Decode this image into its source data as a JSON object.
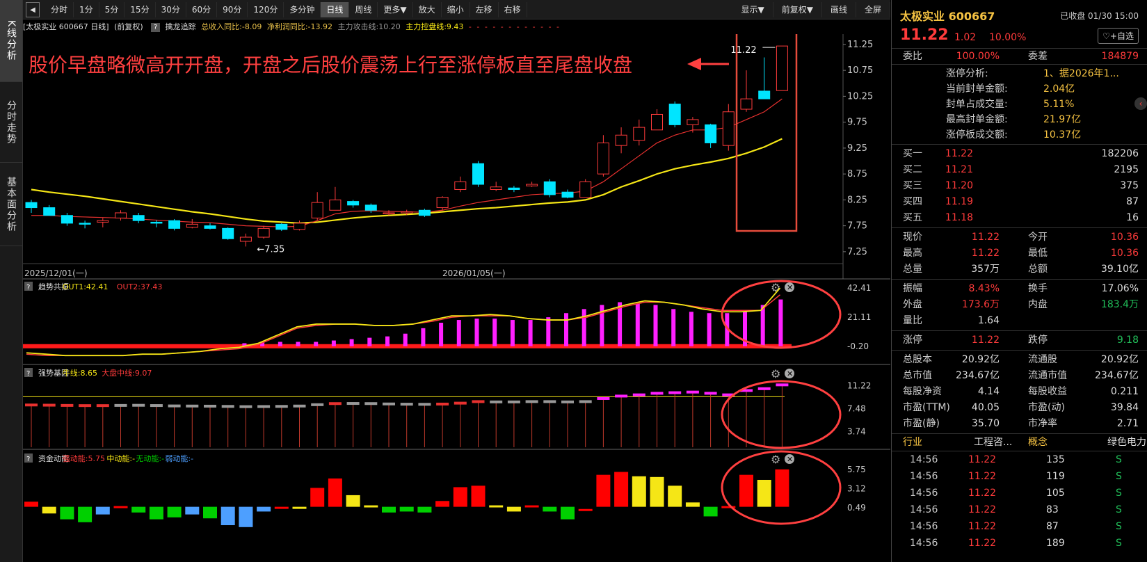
{
  "lefttabs": [
    {
      "label": "K线分析",
      "active": true
    },
    {
      "label": "分时走势",
      "active": false
    },
    {
      "label": "基本面分析",
      "active": false
    }
  ],
  "toolbar": {
    "back": "◀",
    "left": [
      "分时",
      "1分",
      "5分",
      "15分",
      "30分",
      "60分",
      "90分",
      "120分",
      "多分钟",
      "日线",
      "周线",
      "更多▼",
      "放大",
      "缩小",
      "左移",
      "右移"
    ],
    "active": "日线",
    "right": [
      "显示▼",
      "前复权▼",
      "画线",
      "全屏"
    ]
  },
  "infobar": {
    "stock": "[太极实业 600667 日线]",
    "adj": "(前复权)",
    "indicator": "擒龙追踪",
    "rev": "总收入同比:-8.09",
    "profit": "净利润同比:-13.92",
    "attack": "主力攻击线:10.20",
    "control": "主力控盘线:9.43",
    "dash": "- - - - - - - - - - - -"
  },
  "annotation": "股价早盘略微高开开盘，开盘之后股价震荡上行至涨停板直至尾盘收盘",
  "chart_data": [
    {
      "type": "candlestick",
      "title": "擒龙追踪",
      "candles": [
        [
          8.2,
          8.1,
          8.25,
          8.0
        ],
        [
          8.1,
          7.95,
          8.15,
          7.95
        ],
        [
          7.95,
          7.8,
          8.0,
          7.75
        ],
        [
          7.8,
          7.78,
          7.85,
          7.7
        ],
        [
          7.82,
          7.85,
          7.9,
          7.72
        ],
        [
          7.9,
          8.0,
          8.05,
          7.85
        ],
        [
          7.95,
          7.85,
          8.0,
          7.8
        ],
        [
          7.82,
          7.8,
          7.86,
          7.72
        ],
        [
          7.85,
          7.7,
          7.88,
          7.66
        ],
        [
          7.72,
          7.78,
          7.88,
          7.7
        ],
        [
          7.75,
          7.7,
          7.8,
          7.68
        ],
        [
          7.7,
          7.5,
          7.72,
          7.48
        ],
        [
          7.45,
          7.53,
          7.6,
          7.35
        ],
        [
          7.53,
          7.7,
          7.75,
          7.5
        ],
        [
          7.78,
          7.68,
          7.8,
          7.65
        ],
        [
          7.68,
          7.8,
          7.85,
          7.66
        ],
        [
          7.9,
          8.2,
          8.4,
          7.85
        ],
        [
          8.05,
          8.25,
          8.5,
          8.05
        ],
        [
          8.22,
          8.15,
          8.25,
          8.1
        ],
        [
          8.15,
          8.05,
          8.18,
          8.0
        ],
        [
          8.0,
          8.0,
          8.05,
          7.95
        ],
        [
          8.0,
          8.02,
          8.06,
          7.96
        ],
        [
          8.05,
          7.95,
          8.08,
          7.92
        ],
        [
          8.1,
          8.3,
          8.32,
          8.05
        ],
        [
          8.45,
          8.6,
          8.7,
          8.4
        ],
        [
          8.95,
          8.55,
          9.0,
          8.5
        ],
        [
          8.45,
          8.5,
          8.6,
          8.42
        ],
        [
          8.48,
          8.45,
          8.52,
          8.4
        ],
        [
          8.52,
          8.55,
          8.6,
          8.5
        ],
        [
          8.6,
          8.35,
          8.65,
          8.3
        ],
        [
          8.4,
          8.3,
          8.45,
          8.28
        ],
        [
          8.3,
          8.6,
          8.65,
          8.3
        ],
        [
          8.75,
          9.35,
          9.5,
          8.7
        ],
        [
          9.3,
          9.5,
          9.65,
          9.15
        ],
        [
          9.4,
          9.65,
          9.8,
          9.3
        ],
        [
          9.6,
          9.9,
          10.0,
          9.6
        ],
        [
          10.1,
          9.7,
          10.15,
          9.65
        ],
        [
          9.7,
          9.8,
          9.85,
          9.55
        ],
        [
          9.7,
          9.35,
          9.72,
          9.25
        ],
        [
          9.3,
          9.95,
          10.1,
          9.2
        ],
        [
          10.0,
          10.2,
          10.75,
          9.95
        ],
        [
          10.35,
          10.2,
          11.0,
          10.2
        ],
        [
          10.36,
          11.22,
          11.22,
          10.36
        ]
      ],
      "ma_attack": [
        7.95,
        7.95,
        7.93,
        7.92,
        7.91,
        7.9,
        7.88,
        7.86,
        7.84,
        7.82,
        7.81,
        7.78,
        7.75,
        7.74,
        7.73,
        7.74,
        7.85,
        7.98,
        8.03,
        8.04,
        8.03,
        8.02,
        8.01,
        8.05,
        8.13,
        8.2,
        8.25,
        8.3,
        8.35,
        8.37,
        8.38,
        8.42,
        8.6,
        8.85,
        9.1,
        9.35,
        9.5,
        9.6,
        9.6,
        9.65,
        9.8,
        9.95,
        10.2
      ],
      "ma_control": [
        8.45,
        8.4,
        8.36,
        8.32,
        8.27,
        8.22,
        8.17,
        8.12,
        8.07,
        8.02,
        7.98,
        7.93,
        7.88,
        7.84,
        7.82,
        7.8,
        7.82,
        7.86,
        7.9,
        7.93,
        7.95,
        7.97,
        7.99,
        8.02,
        8.05,
        8.08,
        8.1,
        8.13,
        8.16,
        8.19,
        8.21,
        8.25,
        8.35,
        8.5,
        8.62,
        8.75,
        8.85,
        8.92,
        8.98,
        9.05,
        9.15,
        9.27,
        9.43
      ],
      "y_ticks": [
        "11.25",
        "10.75",
        "10.25",
        "9.75",
        "9.25",
        "8.75",
        "8.25",
        "7.75",
        "7.25"
      ],
      "ylim": [
        7.02,
        11.45
      ],
      "x_labels": [
        "2025/12/01(一)",
        "2026/01/05(一)"
      ],
      "high_label": "11.22",
      "low_label": "7.35"
    },
    {
      "type": "bar",
      "title": "趋势共振",
      "series": [
        {
          "name": "OUT1",
          "value_label": "OUT1:42.41",
          "values": [
            -5,
            -6,
            -7,
            -7,
            -7,
            -7,
            -6,
            -6,
            -5,
            -4,
            -2,
            -1,
            2,
            8,
            14,
            16,
            16,
            16,
            15,
            15,
            16,
            19,
            22,
            22,
            23,
            22,
            20,
            19,
            19,
            22,
            26,
            30,
            33,
            32,
            30,
            27,
            25,
            25,
            26,
            42.41
          ]
        },
        {
          "name": "OUT2",
          "value_label": "OUT2:37.43",
          "values": [
            -6,
            -7,
            -7,
            -7,
            -7,
            -7,
            -6,
            -6,
            -5,
            -4,
            -3,
            -2,
            1,
            7,
            13,
            15,
            16,
            16,
            15,
            15,
            16,
            18,
            21,
            22,
            22,
            22,
            20,
            19,
            19,
            21,
            25,
            29,
            32,
            32,
            30,
            28,
            26,
            26,
            26,
            37.43
          ]
        }
      ],
      "bars": [
        0,
        0,
        0,
        0,
        0,
        0,
        0,
        0,
        0,
        0,
        0,
        0,
        0,
        0,
        0,
        0,
        0,
        0,
        0,
        0,
        0,
        0,
        0,
        0,
        0,
        0,
        0,
        0,
        0,
        0,
        0,
        0,
        0,
        0,
        0,
        0,
        0,
        0,
        0,
        0,
        0,
        0,
        0,
        0,
        0,
        0,
        0,
        0,
        0,
        0,
        0,
        0,
        0,
        0,
        0,
        0,
        0,
        0,
        0,
        0,
        0,
        0,
        0,
        0,
        0,
        0,
        0,
        0,
        0,
        0,
        0,
        0,
        0,
        0,
        0,
        0,
        0,
        0,
        0,
        0,
        0,
        0,
        0,
        0,
        0,
        0,
        0,
        0,
        0,
        0,
        0,
        0,
        0,
        0,
        0,
        0,
        0,
        0,
        0,
        0,
        0,
        0,
        0,
        0,
        0,
        0,
        0,
        0,
        0,
        0,
        0,
        0,
        0,
        0,
        0,
        0,
        0,
        0,
        0,
        0
      ],
      "bar_values": [
        2,
        3,
        3,
        3,
        3,
        4,
        5,
        6,
        7,
        9,
        13,
        17,
        19,
        20,
        20,
        19,
        19,
        21,
        24,
        27,
        30,
        32,
        31,
        30,
        27,
        25,
        24,
        24,
        25,
        30,
        34,
        42.41
      ],
      "y_ticks": [
        "42.41",
        "21.11",
        "-0.20"
      ],
      "ylim": [
        -12,
        47
      ]
    },
    {
      "type": "bar",
      "title": "强势基因",
      "series": [
        {
          "name": "牛线",
          "value_label": "牛线:8.65"
        },
        {
          "name": "大盘中线",
          "value_label": "大盘中线:9.07"
        }
      ],
      "levels": [
        7.95,
        7.92,
        7.88,
        7.85,
        7.85,
        7.88,
        7.9,
        7.86,
        7.8,
        7.78,
        7.76,
        7.72,
        7.68,
        7.7,
        7.72,
        7.78,
        8.0,
        8.18,
        8.2,
        8.18,
        8.12,
        8.08,
        8.06,
        8.1,
        8.25,
        8.5,
        8.45,
        8.45,
        8.5,
        8.5,
        8.45,
        8.5,
        9.0,
        9.4,
        9.6,
        9.85,
        9.95,
        10.05,
        9.85,
        9.6,
        10.3,
        10.6,
        11.22
      ],
      "colors": [
        "red",
        "red",
        "red",
        "red",
        "red",
        "gray",
        "gray",
        "gray",
        "gray",
        "gray",
        "gray",
        "gray",
        "gray",
        "gray",
        "gray",
        "gray",
        "gray",
        "red",
        "gray",
        "gray",
        "gray",
        "gray",
        "gray",
        "red",
        "red",
        "red",
        "gray",
        "gray",
        "gray",
        "gray",
        "gray",
        "gray",
        "magenta",
        "magenta",
        "magenta",
        "magenta",
        "magenta",
        "magenta",
        "magenta",
        "magenta",
        "magenta",
        "magenta",
        "magenta"
      ],
      "y_ticks": [
        "11.22",
        "7.48",
        "3.74"
      ],
      "ylim": [
        1.2,
        12.5
      ]
    },
    {
      "type": "bar",
      "title": "资金动能",
      "series": [
        {
          "name": "强动能",
          "value_label": "强动能:5.75"
        },
        {
          "name": "中动能",
          "value_label": "中动能:-"
        },
        {
          "name": "无动能",
          "value_label": "无动能:-"
        },
        {
          "name": "弱动能",
          "value_label": "弱动能:-"
        }
      ],
      "values": [
        1.3,
        -0.4,
        1.0,
        1.3,
        0.5,
        0.7,
        0.3,
        1.0,
        0.8,
        0.5,
        0.9,
        1.6,
        1.8,
        0.2,
        0.6,
        0.6,
        3.2,
        4.5,
        2.2,
        0.8,
        0.3,
        0.2,
        0.3,
        1.4,
        3.3,
        3.5,
        0.8,
        0.2,
        0.8,
        0.2,
        1.0,
        0.3,
        5.0,
        5.4,
        4.8,
        4.7,
        3.5,
        1.2,
        0.7,
        0.7,
        5.0,
        4.3,
        5.75
      ],
      "colors": [
        "red",
        "yellow",
        "green",
        "green",
        "blue",
        "red",
        "green",
        "green",
        "green",
        "blue",
        "green",
        "blue",
        "blue",
        "blue",
        "red",
        "yellow",
        "red",
        "red",
        "yellow",
        "yellow",
        "green",
        "green",
        "green",
        "red",
        "red",
        "red",
        "yellow",
        "yellow",
        "red",
        "green",
        "green",
        "red",
        "red",
        "red",
        "yellow",
        "yellow",
        "yellow",
        "yellow",
        "green",
        "red",
        "red",
        "yellow",
        "red"
      ],
      "down": [
        false,
        true,
        true,
        true,
        true,
        false,
        true,
        true,
        true,
        true,
        true,
        true,
        true,
        true,
        false,
        false,
        false,
        false,
        false,
        false,
        true,
        true,
        true,
        false,
        false,
        false,
        false,
        true,
        false,
        true,
        true,
        false,
        false,
        false,
        false,
        false,
        false,
        false,
        true,
        false,
        false,
        false,
        false
      ],
      "y_ticks": [
        "5.75",
        "3.12",
        "0.49"
      ],
      "ylim": [
        -2.5,
        6.5
      ]
    }
  ],
  "right": {
    "title": "太极实业 600667",
    "status": "已收盘 01/30 15:00",
    "price": "11.22",
    "chg": "1.02",
    "pct": "10.00%",
    "add": "♡+自选",
    "wb_label": "委比",
    "wb_value": "100.00%",
    "wc_label": "委差",
    "wc_value": "184879",
    "zt": [
      {
        "k": "涨停分析:",
        "v": "1、据2026年1..."
      },
      {
        "k": "当前封单金额:",
        "v": "2.04亿"
      },
      {
        "k": "封单占成交量:",
        "v": "5.11%"
      },
      {
        "k": "最高封单金额:",
        "v": "21.97亿"
      },
      {
        "k": "涨停板成交额:",
        "v": "10.37亿"
      }
    ],
    "buys": [
      {
        "k": "买一",
        "p": "11.22",
        "v": "182206"
      },
      {
        "k": "买二",
        "p": "11.21",
        "v": "2195"
      },
      {
        "k": "买三",
        "p": "11.20",
        "v": "375"
      },
      {
        "k": "买四",
        "p": "11.19",
        "v": "87"
      },
      {
        "k": "买五",
        "p": "11.18",
        "v": "16"
      }
    ],
    "stats1": [
      {
        "a": "现价",
        "b": "11.22",
        "bc": "red",
        "c": "今开",
        "d": "10.36",
        "dc": "red"
      },
      {
        "a": "最高",
        "b": "11.22",
        "bc": "red",
        "c": "最低",
        "d": "10.36",
        "dc": "red"
      },
      {
        "a": "总量",
        "b": "357万",
        "bc": "white",
        "c": "总额",
        "d": "39.10亿",
        "dc": "white"
      }
    ],
    "stats2": [
      {
        "a": "振幅",
        "b": "8.43%",
        "bc": "red",
        "c": "换手",
        "d": "17.06%",
        "dc": "white"
      },
      {
        "a": "外盘",
        "b": "173.6万",
        "bc": "red",
        "c": "内盘",
        "d": "183.4万",
        "dc": "green"
      },
      {
        "a": "量比",
        "b": "1.64",
        "bc": "white",
        "c": "",
        "d": "",
        "dc": "white"
      }
    ],
    "stats3": [
      {
        "a": "涨停",
        "b": "11.22",
        "bc": "red",
        "c": "跌停",
        "d": "9.18",
        "dc": "green"
      }
    ],
    "stats4": [
      {
        "a": "总股本",
        "b": "20.92亿",
        "bc": "white",
        "c": "流通股",
        "d": "20.92亿",
        "dc": "white"
      },
      {
        "a": "总市值",
        "b": "234.67亿",
        "bc": "white",
        "c": "流通市值",
        "d": "234.67亿",
        "dc": "white"
      },
      {
        "a": "每股净资",
        "b": "4.14",
        "bc": "white",
        "c": "每股收益",
        "d": "0.211",
        "dc": "white"
      },
      {
        "a": "市盈(TTM)",
        "b": "40.05",
        "bc": "white",
        "c": "市盈(动)",
        "d": "39.84",
        "dc": "white"
      },
      {
        "a": "市盈(静)",
        "b": "35.70",
        "bc": "white",
        "c": "市净率",
        "d": "2.71",
        "dc": "white"
      }
    ],
    "industry": {
      "k1": "行业",
      "v1": "工程咨...",
      "k2": "概念",
      "v2": "绿色电力"
    },
    "ticks": [
      {
        "t": "14:56",
        "p": "11.22",
        "v": "135",
        "s": "S"
      },
      {
        "t": "14:56",
        "p": "11.22",
        "v": "119",
        "s": "S"
      },
      {
        "t": "14:56",
        "p": "11.22",
        "v": "105",
        "s": "S"
      },
      {
        "t": "14:56",
        "p": "11.22",
        "v": "83",
        "s": "S"
      },
      {
        "t": "14:56",
        "p": "11.22",
        "v": "87",
        "s": "S"
      },
      {
        "t": "14:56",
        "p": "11.22",
        "v": "189",
        "s": "S"
      }
    ]
  },
  "colors": {
    "up": "#ff3b3b",
    "down": "#00e5ff",
    "ma1": "#e8312f",
    "ma2": "#f5e616",
    "magenta": "#ff20ff",
    "yellow": "#f5e616",
    "green": "#00d000",
    "blue": "#4d9fff",
    "annot": "#ff4040"
  }
}
